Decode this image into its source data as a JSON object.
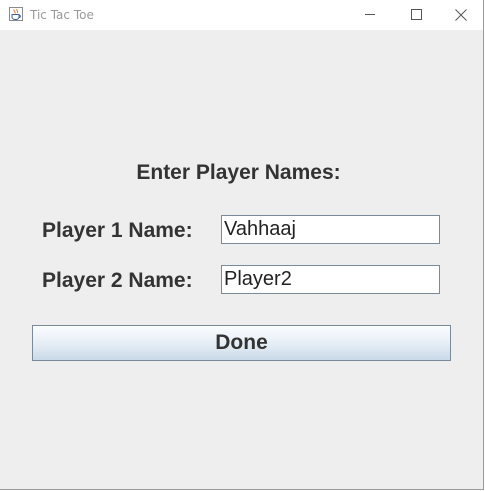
{
  "window": {
    "title": "Tic Tac Toe",
    "app_icon": "java-cup-icon",
    "controls": [
      "minimize-icon",
      "maximize-icon",
      "close-icon"
    ]
  },
  "form": {
    "heading": "Enter Player Names:",
    "player1": {
      "label": "Player 1 Name:",
      "value": "Vahhaaj"
    },
    "player2": {
      "label": "Player 2 Name:",
      "value": "Player2"
    },
    "done_label": "Done"
  },
  "colors": {
    "background": "#eeeeee",
    "text": "#333333",
    "field_border": "#7a8a99",
    "button_gradient_top": "#fbfdff",
    "button_gradient_bottom": "#c9d9e8"
  }
}
